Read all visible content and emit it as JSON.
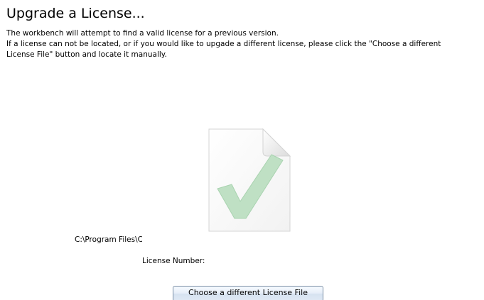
{
  "page": {
    "title": "Upgrade a License...",
    "description_lines": [
      "The workbench will attempt to find a valid license for a previous version.",
      "If a license can not be located, or if you would like to upgade a different license, please click the \"Choose a different",
      "License File\" button and locate it manually."
    ]
  },
  "license": {
    "icon": "license-file-check-icon",
    "path": "C:\\Program Files\\CLC",
    "number_label": "License Number:",
    "number_value": ""
  },
  "actions": {
    "choose_button_label": "Choose a different License File"
  },
  "colors": {
    "checkmark": "#bfe0c4",
    "document_fill": "#fbfbfb",
    "document_border": "#d4d4d4",
    "button_border": "#7a8ea5"
  }
}
